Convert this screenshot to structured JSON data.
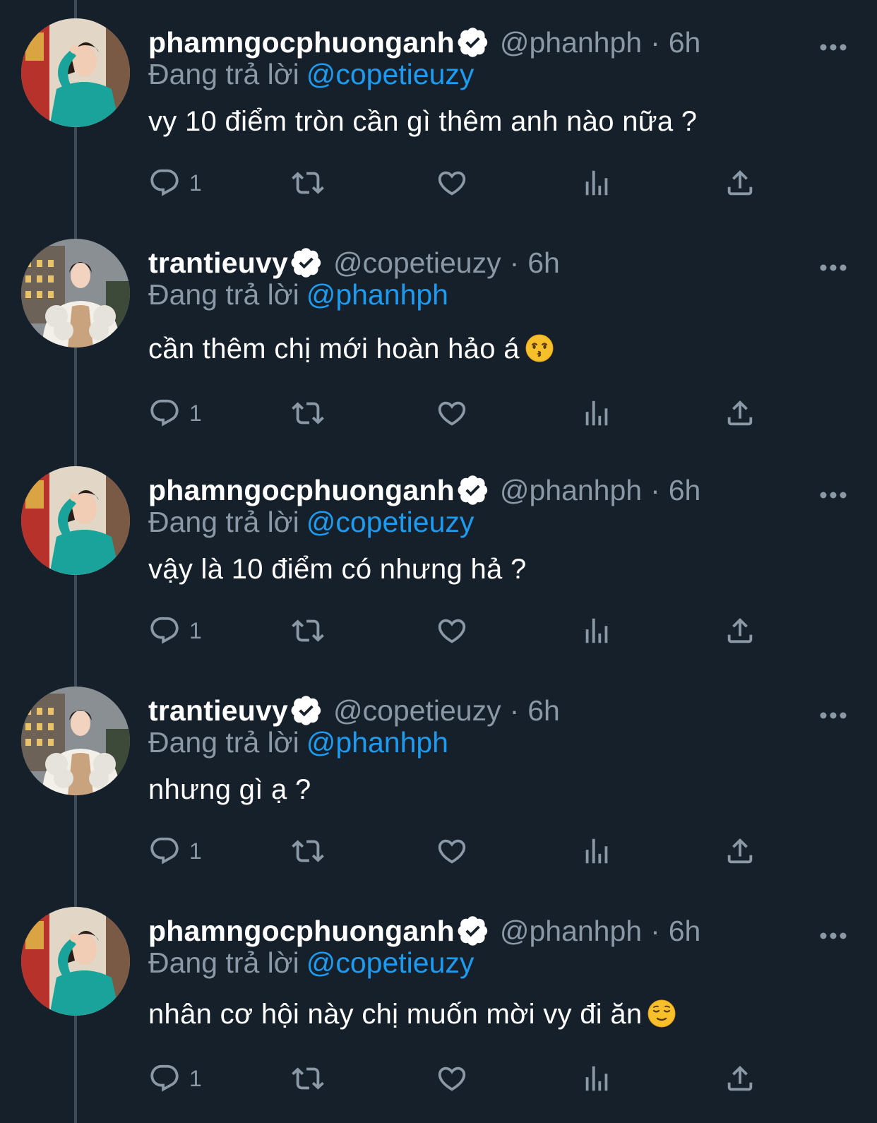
{
  "colors": {
    "background": "#15202b",
    "secondary_text": "#8b98a5",
    "link": "#1d9bf0",
    "thread_line": "#3d4a57"
  },
  "reply_prefix": "Đang trả lời",
  "tweets": [
    {
      "author": "phamngocphuonganh",
      "handle": "@phanhph",
      "separator": "·",
      "time": "6h",
      "reply_to": "@copetieuzy",
      "text": "vy 10 điểm tròn cần gì thêm anh nào nữa ?",
      "reply_count": "1",
      "avatar": "avatar-woman-teal-dress"
    },
    {
      "author": "trantieuvy",
      "handle": "@copetieuzy",
      "separator": "·",
      "time": "6h",
      "reply_to": "@phanhph",
      "text": "cần thêm chị mới hoàn hảo á",
      "emoji": "kissing-face-emoji",
      "reply_count": "1",
      "avatar": "avatar-woman-white-fur"
    },
    {
      "author": "phamngocphuonganh",
      "handle": "@phanhph",
      "separator": "·",
      "time": "6h",
      "reply_to": "@copetieuzy",
      "text": "vậy là 10 điểm có nhưng hả ?",
      "reply_count": "1",
      "avatar": "avatar-woman-teal-dress"
    },
    {
      "author": "trantieuvy",
      "handle": "@copetieuzy",
      "separator": "·",
      "time": "6h",
      "reply_to": "@phanhph",
      "text": "nhưng gì ạ ?",
      "reply_count": "1",
      "avatar": "avatar-woman-white-fur"
    },
    {
      "author": "phamngocphuonganh",
      "handle": "@phanhph",
      "separator": "·",
      "time": "6h",
      "reply_to": "@copetieuzy",
      "text": "nhân cơ hội này chị muốn mời vy đi ăn",
      "emoji": "relieved-face-emoji",
      "reply_count": "1",
      "avatar": "avatar-woman-teal-dress"
    }
  ]
}
